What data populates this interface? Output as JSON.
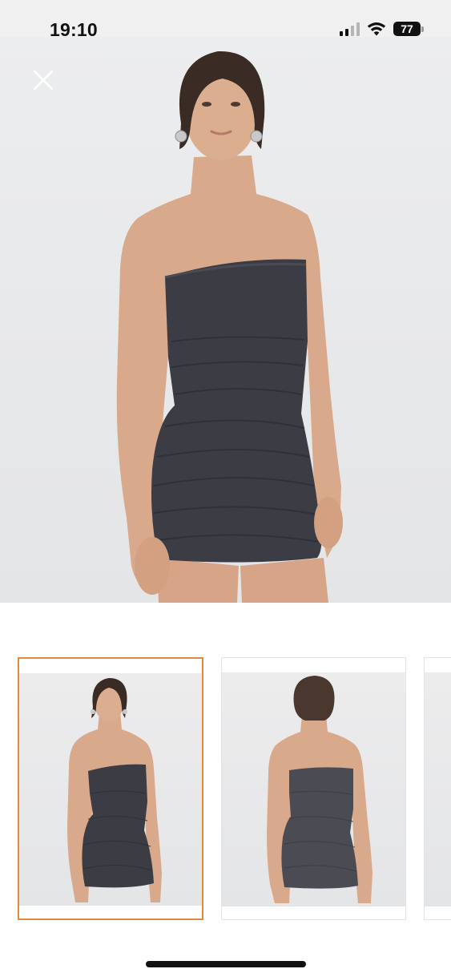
{
  "status_bar": {
    "time": "19:10",
    "battery_level": "77",
    "signal_icon": "cellular-signal-icon",
    "wifi_icon": "wifi-icon",
    "battery_icon": "battery-icon"
  },
  "viewer": {
    "close_icon": "close-icon",
    "hero_image": "product-photo-front",
    "thumbnails": [
      {
        "image": "product-photo-front",
        "selected": true
      },
      {
        "image": "product-photo-back",
        "selected": false
      },
      {
        "image": "product-photo-3",
        "selected": false
      }
    ]
  },
  "colors": {
    "selected_border": "#e08a3c",
    "dress": "#3b3c44",
    "skin": "#d8a88a",
    "hair": "#3a2b24",
    "background": "#ececed"
  }
}
